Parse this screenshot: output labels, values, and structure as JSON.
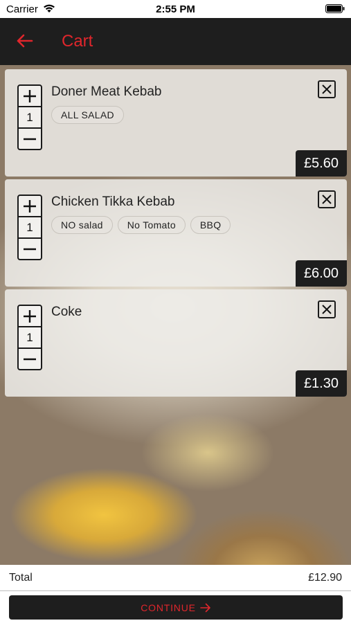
{
  "status_bar": {
    "carrier": "Carrier",
    "time": "2:55 PM"
  },
  "nav": {
    "title": "Cart",
    "back_icon": "arrow-left-icon"
  },
  "colors": {
    "accent": "#e0262c",
    "bar": "#1e1e1e"
  },
  "cart": {
    "items": [
      {
        "name": "Doner Meat Kebab",
        "quantity": "1",
        "options": [
          "ALL SALAD"
        ],
        "price": "£5.60"
      },
      {
        "name": "Chicken Tikka Kebab",
        "quantity": "1",
        "options": [
          "NO salad",
          "No Tomato",
          "BBQ"
        ],
        "price": "£6.00"
      },
      {
        "name": "Coke",
        "quantity": "1",
        "options": [],
        "price": "£1.30"
      }
    ]
  },
  "footer": {
    "total_label": "Total",
    "total_value": "£12.90",
    "continue_label": "CONTINUE"
  }
}
